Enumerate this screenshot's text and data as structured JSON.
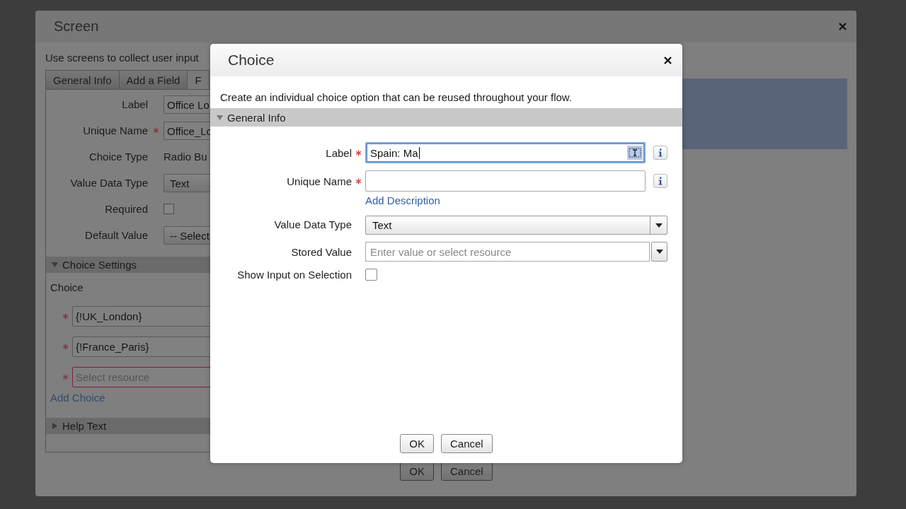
{
  "background_dialog": {
    "title": "Screen",
    "description": "Use screens to collect user input",
    "tabs": [
      {
        "label": "General Info",
        "selected": false
      },
      {
        "label": "Add a Field",
        "selected": false
      },
      {
        "label": "F",
        "selected": true
      }
    ],
    "fields": [
      {
        "kind": "input",
        "label": "Label",
        "required": false,
        "value": "Office Lo"
      },
      {
        "kind": "input",
        "label": "Unique Name",
        "required": true,
        "value": "Office_Lo"
      },
      {
        "kind": "text",
        "label": "Choice Type",
        "required": false,
        "value": "Radio Bu"
      },
      {
        "kind": "select",
        "label": "Value Data Type",
        "required": false,
        "value": "Text"
      },
      {
        "kind": "checkbox",
        "label": "Required",
        "required": false,
        "checked": false
      },
      {
        "kind": "select",
        "label": "Default Value",
        "required": false,
        "value": "-- Select"
      }
    ],
    "choice_settings": {
      "title": "Choice Settings",
      "expanded": true,
      "choice_label": "Choice",
      "choices": [
        {
          "value": "{!UK_London}",
          "required": true,
          "error": false
        },
        {
          "value": "{!France_Paris}",
          "required": true,
          "error": false
        },
        {
          "placeholder": "Select resource",
          "required": true,
          "error": true
        }
      ],
      "add_link": "Add Choice"
    },
    "help_text": {
      "title": "Help Text",
      "expanded": false
    },
    "buttons": [
      "OK",
      "Cancel"
    ]
  },
  "modal": {
    "title": "Choice",
    "description": "Create an individual choice option that can be reused throughout your flow.",
    "section": {
      "title": "General Info",
      "expanded": true
    },
    "fields": [
      {
        "kind": "input",
        "label": "Label",
        "required": true,
        "value": "Spain: Ma",
        "focused": true,
        "info": true
      },
      {
        "kind": "input",
        "label": "Unique Name",
        "required": true,
        "focused": false,
        "info": true,
        "link": "Add Description"
      },
      {
        "kind": "select",
        "label": "Value Data Type",
        "required": false,
        "value": "Text"
      },
      {
        "kind": "combo",
        "label": "Stored Value",
        "required": false,
        "placeholder": "Enter value or select resource"
      },
      {
        "kind": "checkbox",
        "label": "Show Input on Selection",
        "required": false,
        "checked": false
      }
    ],
    "buttons": [
      "OK",
      "Cancel"
    ]
  }
}
